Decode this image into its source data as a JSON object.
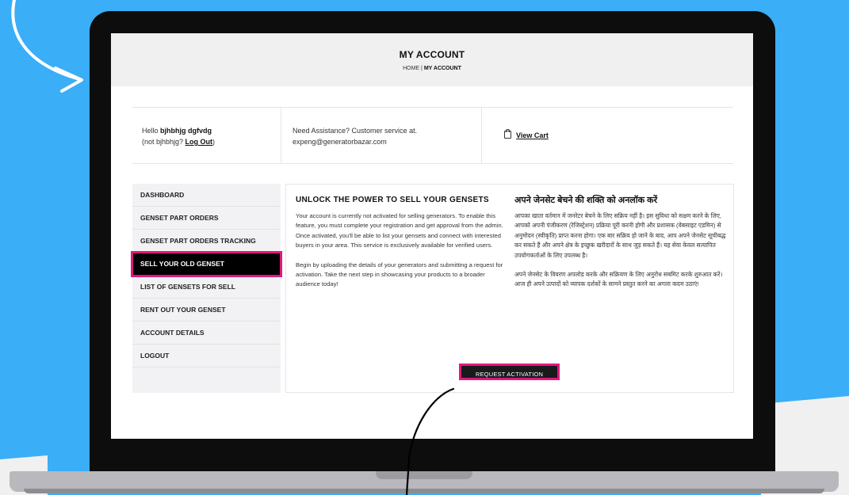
{
  "page": {
    "title": "MY ACCOUNT",
    "breadcrumb_home": "HOME",
    "breadcrumb_sep": "|",
    "breadcrumb_current": "MY ACCOUNT"
  },
  "info": {
    "hello_prefix": "Hello ",
    "user_name": "bjhbhjg dgfvdg",
    "not_prefix": "(not bjhbhjg? ",
    "logout_link": "Log Out",
    "not_suffix": ")",
    "assist_line1": "Need Assistance? Customer service at.",
    "assist_email": "expeng@generatorbazar.com",
    "view_cart": "View Cart"
  },
  "sidebar": {
    "items": [
      {
        "label": "DASHBOARD"
      },
      {
        "label": "GENSET PART ORDERS"
      },
      {
        "label": "GENSET PART ORDERS TRACKING"
      },
      {
        "label": "SELL YOUR OLD GENSET"
      },
      {
        "label": "LIST OF GENSETS FOR SELL"
      },
      {
        "label": "RENT OUT YOUR GENSET"
      },
      {
        "label": "ACCOUNT DETAILS"
      },
      {
        "label": "LOGOUT"
      }
    ],
    "active_index": 3
  },
  "content": {
    "en_heading": "UNLOCK THE POWER TO SELL YOUR GENSETS",
    "en_p1": "Your account is currently not activated for selling generators. To enable this feature, you must complete your registration and get approval from the admin. Once activated, you'll be able to list your gensets and connect with interested buyers in your area. This service is exclusively available for verified users.",
    "en_p2": "Begin by uploading the details of your generators and submitting a request for activation. Take the next step in showcasing your products to a broader audience today!",
    "hi_heading": "अपने जेनसेट बेचने की शक्ति को अनलॉक करें",
    "hi_p1": "आपका खाता वर्तमान में जनरेटर बेचने के लिए सक्रिय नहीं है। इस सुविधा को सक्षम करने के लिए, आपको अपनी पंजीकरण (रेजिस्ट्रेशन) प्रक्रिया पूरी करनी होगी और प्रशासक (वेबसाइट एडमिन) से अनुमोदन (स्वीकृति) प्राप्त करना होगा। एक बार सक्रिय हो जाने के बाद, आप अपने जेनसेट सूचीबद्ध कर सकते हैं और अपने क्षेत्र के इच्छुक खरीदारों के साथ जुड़ सकते हैं। यह सेवा केवल सत्यापित उपयोगकर्ताओं के लिए उपलब्ध है।",
    "hi_p2": "अपने जेनसेट के विवरण अपलोड करके और सक्रियण के लिए अनुरोध सबमिट करके शुरुआत करें। आज ही अपने उत्पादों को व्यापक दर्शकों के सामने प्रस्तुत करने का अगला कदम उठाएं!",
    "request_button": "REQUEST ACTIVATION"
  },
  "colors": {
    "background": "#3aaef7",
    "highlight": "#e0187e",
    "bezel": "#0d0d0d",
    "button": "#1a1a1a"
  }
}
